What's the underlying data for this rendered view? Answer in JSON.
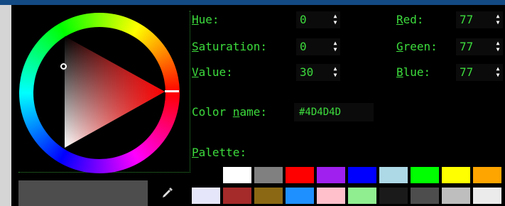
{
  "fields": {
    "hue": {
      "label_pre": "",
      "label_key": "H",
      "label_post": "ue:",
      "value": "0"
    },
    "saturation": {
      "label_pre": "",
      "label_key": "S",
      "label_post": "aturation:",
      "value": "0"
    },
    "value": {
      "label_pre": "",
      "label_key": "V",
      "label_post": "alue:",
      "value": "30"
    },
    "red": {
      "label_pre": "",
      "label_key": "R",
      "label_post": "ed:",
      "value": "77"
    },
    "green": {
      "label_pre": "",
      "label_key": "G",
      "label_post": "reen:",
      "value": "77"
    },
    "blue": {
      "label_pre": "",
      "label_key": "B",
      "label_post": "lue:",
      "value": "77"
    }
  },
  "color_name": {
    "label_pre": "Color ",
    "label_key": "n",
    "label_post": "ame:",
    "value": "#4D4D4D"
  },
  "palette": {
    "label_key": "P",
    "label_post": "alette:",
    "row1": [
      "#000000",
      "#ffffff",
      "#808080",
      "#ff0000",
      "#a020f0",
      "#0000ff",
      "#add8e6",
      "#00ff00",
      "#ffff00",
      "#ffa500"
    ],
    "row2": [
      "#e6e6fa",
      "#a52a2a",
      "#8b6914",
      "#1e90ff",
      "#ffc0cb",
      "#90ee90",
      "#1a1a1a",
      "#4d4d4d",
      "#bebebe",
      "#ebebeb"
    ]
  },
  "current_color": "#4d4d4d",
  "accent_color": "#3ddc3d",
  "icons": {
    "spinner": "up-down-arrows",
    "eyedropper": "eyedropper-icon"
  }
}
